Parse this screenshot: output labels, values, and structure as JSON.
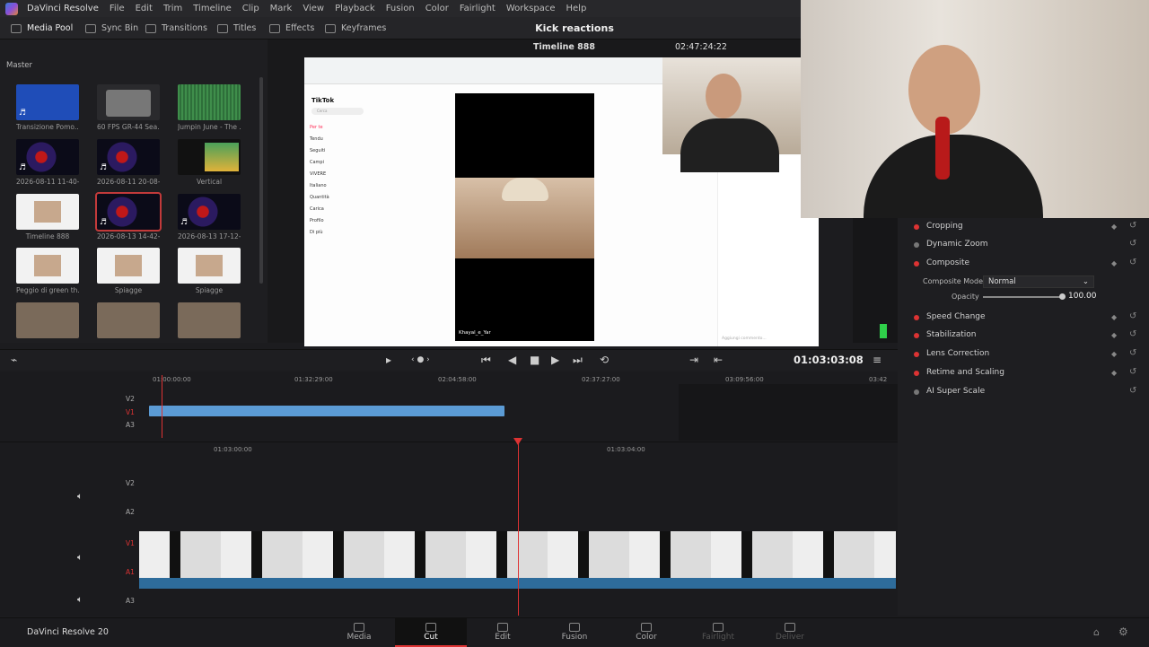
{
  "menubar": {
    "app_name": "DaVinci Resolve",
    "items": [
      "File",
      "Edit",
      "Trim",
      "Timeline",
      "Clip",
      "Mark",
      "View",
      "Playback",
      "Fusion",
      "Color",
      "Fairlight",
      "Workspace",
      "Help"
    ]
  },
  "toolbar": {
    "media_pool": "Media Pool",
    "sync_bin": "Sync Bin",
    "transitions": "Transitions",
    "titles": "Titles",
    "effects": "Effects",
    "keyframes": "Keyframes",
    "project_title": "Kick reactions"
  },
  "media_pool": {
    "bin": "Master",
    "clips": [
      {
        "label": "Transizione Pomo...",
        "kind": "blue",
        "note": true
      },
      {
        "label": "60 FPS GR-44 Sea...",
        "kind": "folder",
        "note": false
      },
      {
        "label": "Jumpin June - The ...",
        "kind": "audio",
        "note": false
      },
      {
        "label": "2026-08-11 11-40-...",
        "kind": "dark",
        "note": true
      },
      {
        "label": "2026-08-11 20-08-...",
        "kind": "dark",
        "note": true
      },
      {
        "label": "Vertical",
        "kind": "vert",
        "note": false
      },
      {
        "label": "Timeline 888",
        "kind": "doc",
        "note": false
      },
      {
        "label": "2026-08-13 14-42-...",
        "kind": "dark",
        "note": true,
        "selected": true
      },
      {
        "label": "2026-08-13 17-12-...",
        "kind": "dark",
        "note": true
      },
      {
        "label": "Peggio di green th...",
        "kind": "doc",
        "note": false
      },
      {
        "label": "Spiagge",
        "kind": "doc",
        "note": false
      },
      {
        "label": "Spiagge",
        "kind": "doc",
        "note": false
      },
      {
        "label": "",
        "kind": "face",
        "note": false
      },
      {
        "label": "",
        "kind": "face",
        "note": false
      },
      {
        "label": "",
        "kind": "face",
        "note": false
      }
    ]
  },
  "viewer": {
    "timeline_name": "Timeline 888",
    "duration": "02:47:24:22",
    "screen": {
      "brand": "TikTok",
      "search_placeholder": "Cerca",
      "nav": [
        "Per te",
        "Tendu",
        "Seguiti",
        "Campi",
        "VIVERE",
        "Italiano",
        "Quantità",
        "Carica",
        "Profilo",
        "Di più"
      ],
      "caption_user": "Khayal_e_Yar",
      "comment_placeholder": "Aggiungi commento..."
    }
  },
  "inspector": {
    "items": [
      {
        "label": "Cropping",
        "active": true
      },
      {
        "label": "Dynamic Zoom",
        "active": false
      },
      {
        "label": "Composite",
        "active": true
      },
      {
        "label": "Speed Change",
        "active": true
      },
      {
        "label": "Stabilization",
        "active": true
      },
      {
        "label": "Lens Correction",
        "active": true
      },
      {
        "label": "Retime and Scaling",
        "active": true
      },
      {
        "label": "AI Super Scale",
        "active": false
      }
    ],
    "composite_mode_label": "Composite Mode",
    "composite_mode_value": "Normal",
    "opacity_label": "Opacity",
    "opacity_value": "100.00",
    "opacity_fraction": 1.0
  },
  "transport": {
    "timecode": "01:03:03:08"
  },
  "timeline": {
    "upper_ruler": [
      "01:00:00:00",
      "01:32:29:00",
      "02:04:58:00",
      "02:37:27:00",
      "03:09:56:00",
      "03:42"
    ],
    "lower_ruler": [
      "01:03:00:00",
      "01:03:04:00"
    ],
    "tracks_upper": [
      "V2",
      "V1",
      "A3"
    ],
    "tracks_lower": [
      "V2",
      "A2",
      "V1",
      "A1",
      "A3"
    ]
  },
  "pages": [
    {
      "label": "Media",
      "active": false,
      "dim": false
    },
    {
      "label": "Cut",
      "active": true,
      "dim": false
    },
    {
      "label": "Edit",
      "active": false,
      "dim": false
    },
    {
      "label": "Fusion",
      "active": false,
      "dim": false
    },
    {
      "label": "Color",
      "active": false,
      "dim": false
    },
    {
      "label": "Fairlight",
      "active": false,
      "dim": true
    },
    {
      "label": "Deliver",
      "active": false,
      "dim": true
    }
  ],
  "brand": "DaVinci Resolve 20",
  "colors": {
    "accent": "#d33333",
    "clip_blue": "#5b9bd5",
    "selected_outline": "#c23a3a"
  }
}
